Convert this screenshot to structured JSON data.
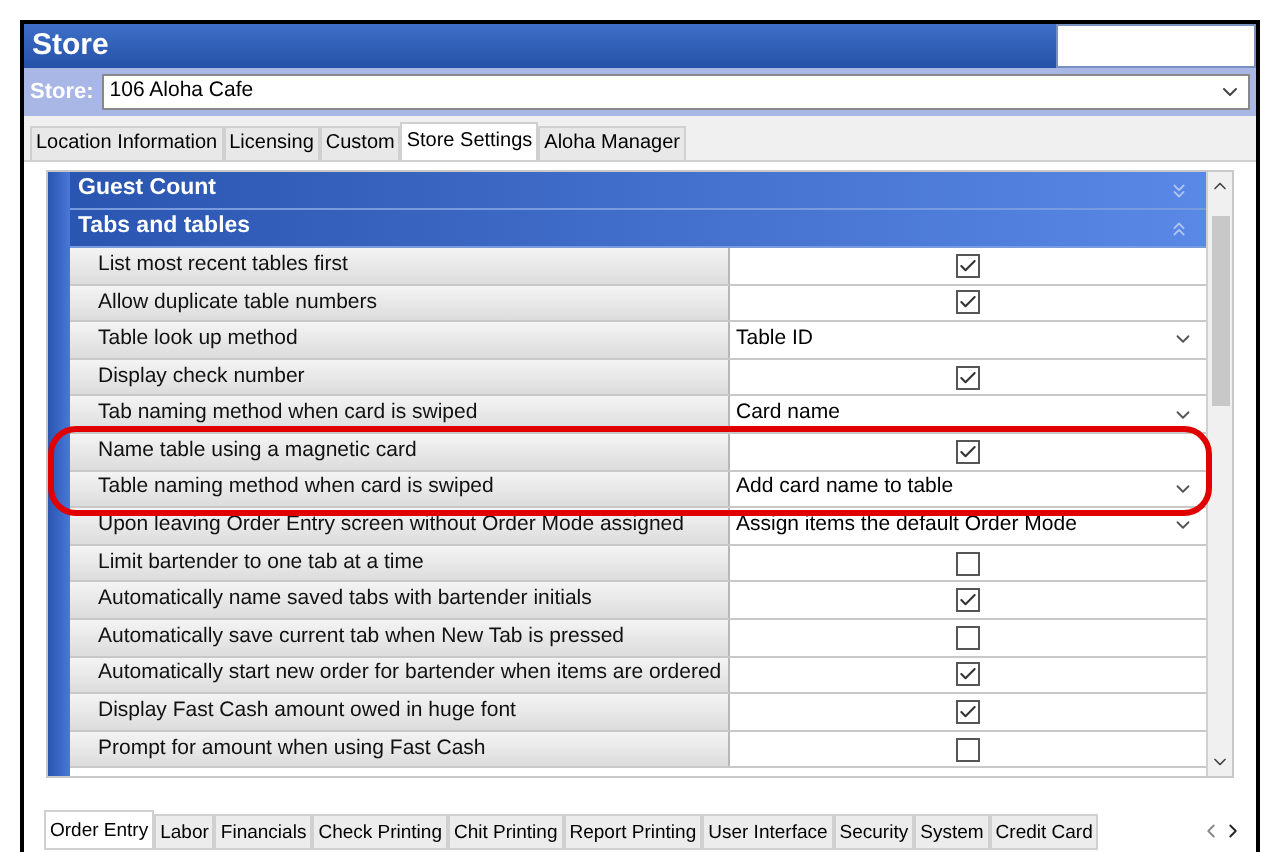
{
  "window": {
    "title": "Store"
  },
  "store": {
    "label": "Store:",
    "value": "106 Aloha Cafe"
  },
  "tabs": [
    {
      "label": "Location Information",
      "selected": false
    },
    {
      "label": "Licensing",
      "selected": false
    },
    {
      "label": "Custom",
      "selected": false
    },
    {
      "label": "Store Settings",
      "selected": true
    },
    {
      "label": "Aloha Manager",
      "selected": false
    }
  ],
  "groups": [
    {
      "title": "Guest Count",
      "expanded": false
    },
    {
      "title": "Tabs and tables",
      "expanded": true
    }
  ],
  "settings": [
    {
      "label": "List most recent tables first",
      "kind": "checkbox",
      "checked": true
    },
    {
      "label": "Allow duplicate table numbers",
      "kind": "checkbox",
      "checked": true
    },
    {
      "label": "Table look up method",
      "kind": "dropdown",
      "value": "Table ID"
    },
    {
      "label": "Display check number",
      "kind": "checkbox",
      "checked": true
    },
    {
      "label": "Tab naming method when card is swiped",
      "kind": "dropdown",
      "value": "Card name"
    },
    {
      "label": "Name table using a magnetic card",
      "kind": "checkbox",
      "checked": true,
      "highlighted": true
    },
    {
      "label": "Table naming method when card is swiped",
      "kind": "dropdown",
      "value": "Add card name to table",
      "highlighted": true
    },
    {
      "label": "Upon leaving Order Entry screen without Order Mode assigned",
      "kind": "dropdown",
      "value": "Assign items the default Order Mode"
    },
    {
      "label": "Limit bartender to one tab at a time",
      "kind": "checkbox",
      "checked": false
    },
    {
      "label": "Automatically name saved tabs with bartender initials",
      "kind": "checkbox",
      "checked": true
    },
    {
      "label": "Automatically save current tab when New Tab is pressed",
      "kind": "checkbox",
      "checked": false
    },
    {
      "label": "Automatically start new order for bartender when items are ordered",
      "kind": "checkbox",
      "checked": true
    },
    {
      "label": "Display Fast Cash amount owed in huge font",
      "kind": "checkbox",
      "checked": true
    },
    {
      "label": "Prompt for amount when using Fast Cash",
      "kind": "checkbox",
      "checked": false
    }
  ],
  "bottom_tabs": [
    {
      "label": "Order Entry",
      "selected": true
    },
    {
      "label": "Labor",
      "selected": false
    },
    {
      "label": "Financials",
      "selected": false
    },
    {
      "label": "Check Printing",
      "selected": false
    },
    {
      "label": "Chit Printing",
      "selected": false
    },
    {
      "label": "Report Printing",
      "selected": false
    },
    {
      "label": "User Interface",
      "selected": false
    },
    {
      "label": "Security",
      "selected": false
    },
    {
      "label": "System",
      "selected": false
    },
    {
      "label": "Credit Card",
      "selected": false
    }
  ]
}
